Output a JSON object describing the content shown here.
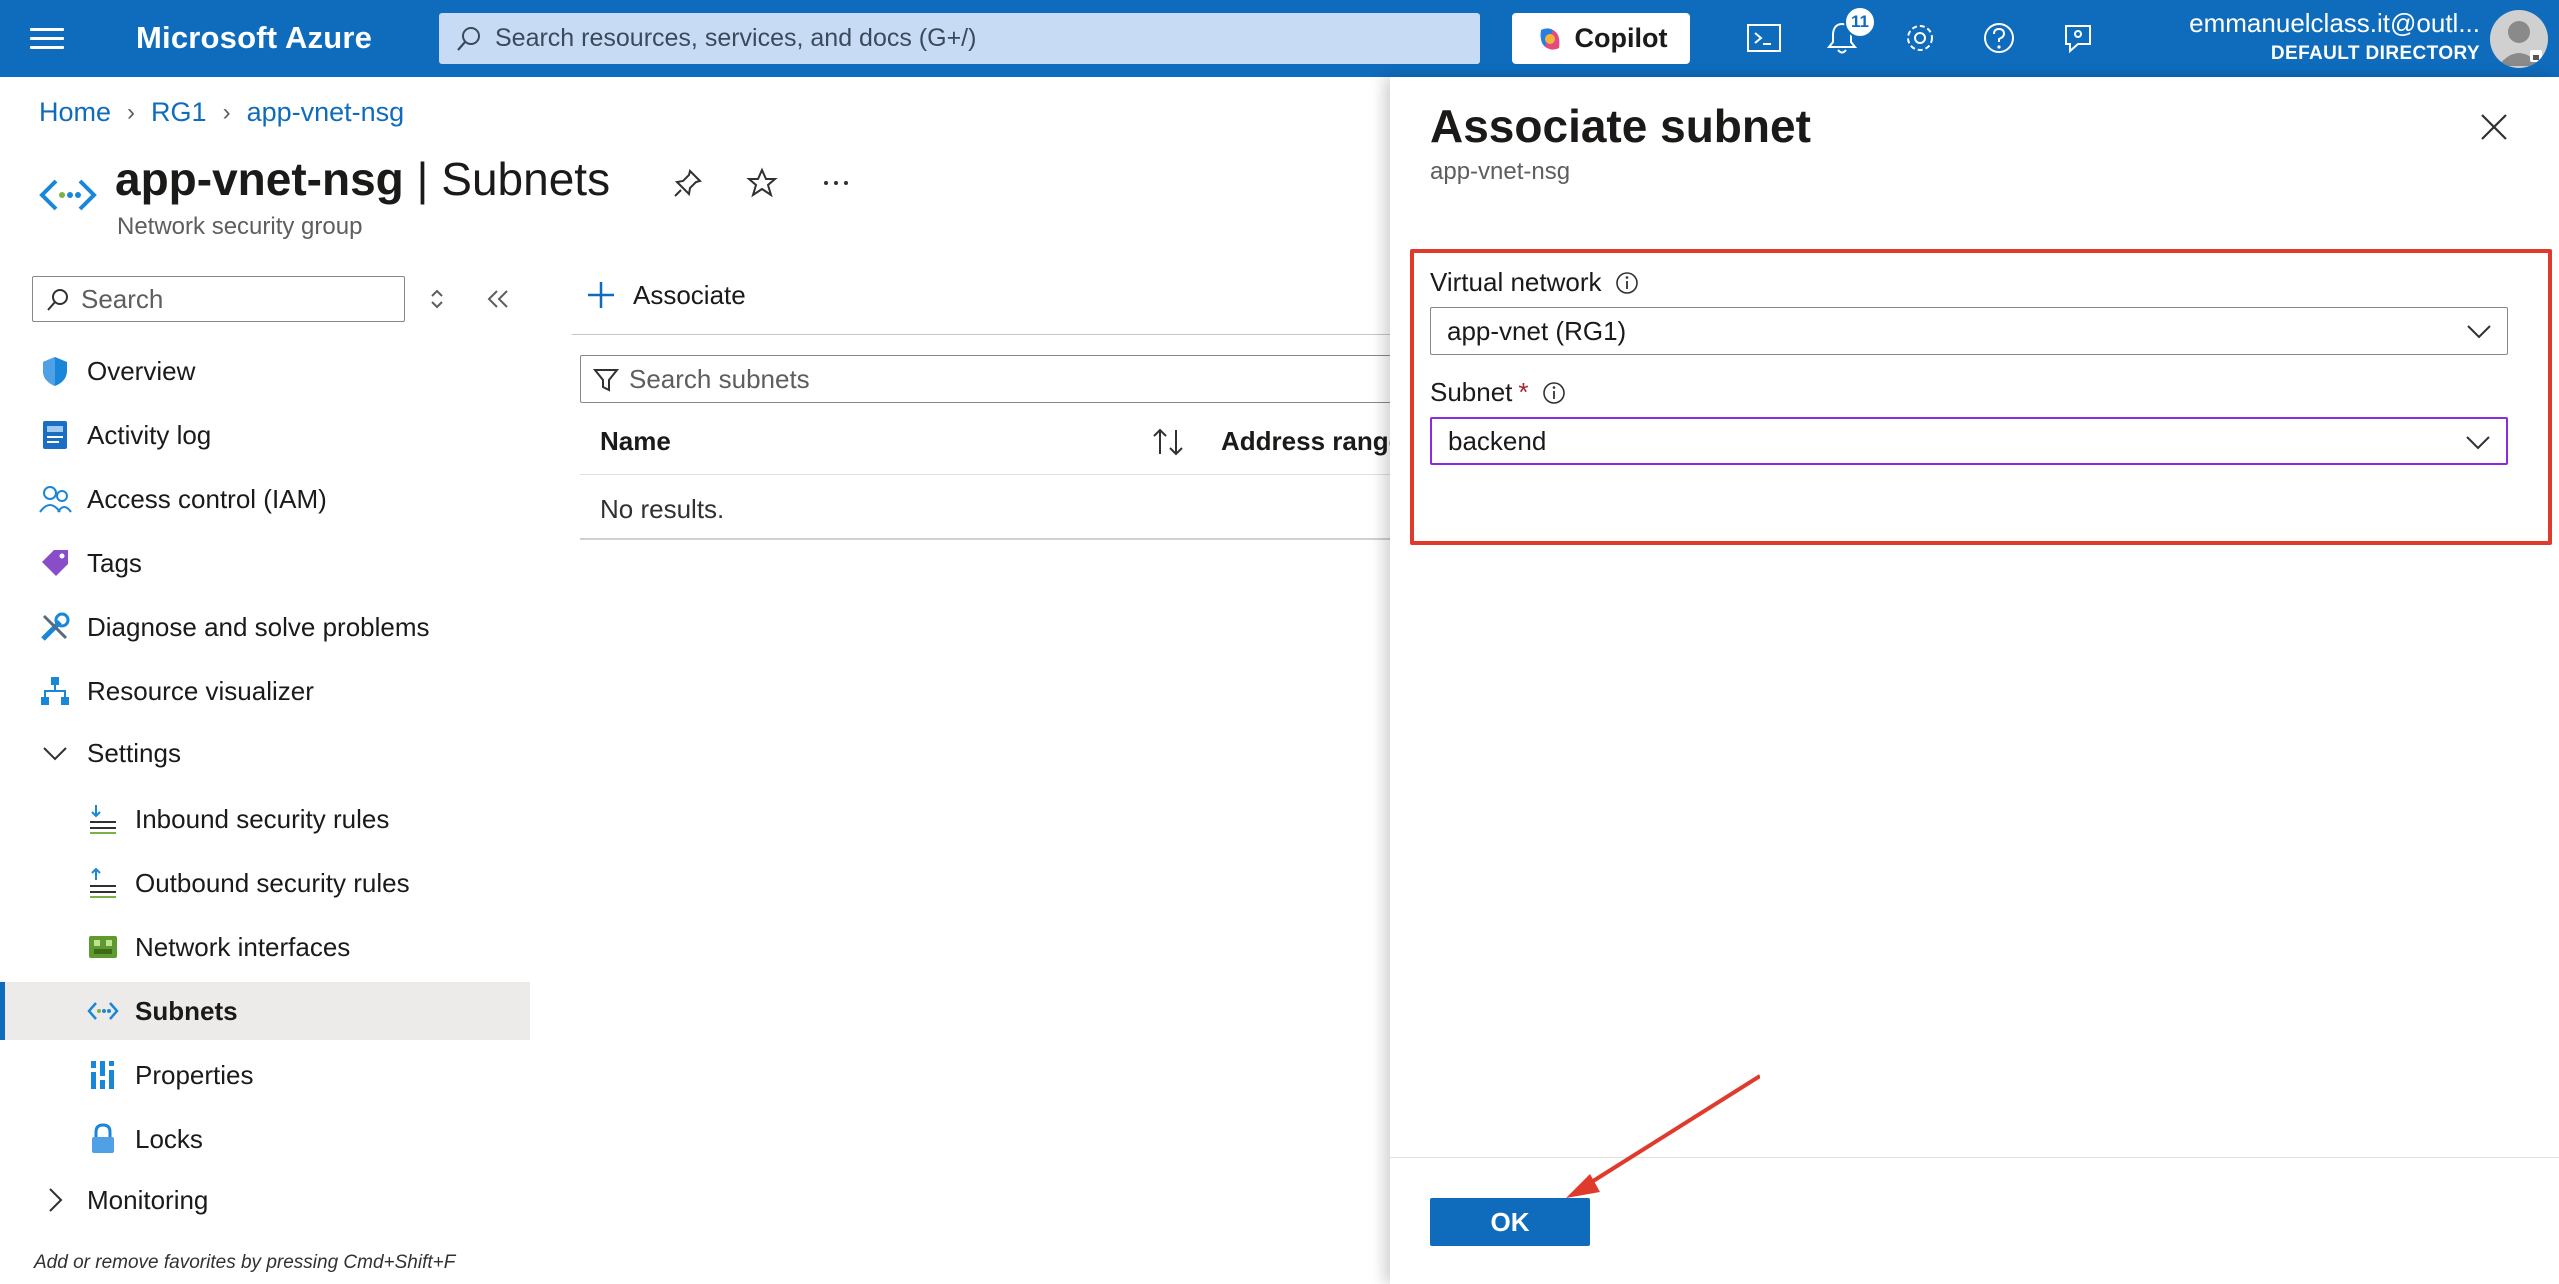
{
  "topbar": {
    "brand": "Microsoft Azure",
    "search_placeholder": "Search resources, services, and docs (G+/)",
    "copilot_label": "Copilot",
    "notification_count": "11",
    "account_email": "emmanuelclass.it@outl...",
    "account_directory": "DEFAULT DIRECTORY",
    "icons": [
      "cloud-shell-icon",
      "notifications-icon",
      "settings-icon",
      "help-icon",
      "feedback-icon"
    ]
  },
  "breadcrumb": {
    "items": [
      "Home",
      "RG1",
      "app-vnet-nsg"
    ]
  },
  "page": {
    "resource_name": "app-vnet-nsg",
    "section": " | Subnets",
    "subtitle": "Network security group"
  },
  "left_menu": {
    "search_placeholder": "Search",
    "items": [
      {
        "label": "Overview",
        "icon": "shield-icon"
      },
      {
        "label": "Activity log",
        "icon": "activity-log-icon"
      },
      {
        "label": "Access control (IAM)",
        "icon": "people-icon"
      },
      {
        "label": "Tags",
        "icon": "tag-icon"
      },
      {
        "label": "Diagnose and solve problems",
        "icon": "wrench-icon"
      },
      {
        "label": "Resource visualizer",
        "icon": "hierarchy-icon"
      },
      {
        "label": "Settings",
        "icon": "chevron-down-icon"
      },
      {
        "label": "Inbound security rules",
        "icon": "inbound-rules-icon"
      },
      {
        "label": "Outbound security rules",
        "icon": "outbound-rules-icon"
      },
      {
        "label": "Network interfaces",
        "icon": "network-interface-icon"
      },
      {
        "label": "Subnets",
        "icon": "subnet-icon",
        "selected": true
      },
      {
        "label": "Properties",
        "icon": "properties-icon"
      },
      {
        "label": "Locks",
        "icon": "lock-icon"
      },
      {
        "label": "Monitoring",
        "icon": "chevron-right-icon"
      }
    ],
    "favorites_hint": "Add or remove favorites by pressing Cmd+Shift+F"
  },
  "content": {
    "associate_label": "Associate",
    "search_placeholder": "Search subnets",
    "columns": [
      "Name",
      "Address range"
    ],
    "empty_text": "No results."
  },
  "panel": {
    "title": "Associate subnet",
    "subtitle": "app-vnet-nsg",
    "vnet_label": "Virtual network",
    "vnet_value": "app-vnet (RG1)",
    "subnet_label": "Subnet",
    "subnet_required": "*",
    "subnet_value": "backend",
    "ok_label": "OK"
  },
  "colors": {
    "azure_blue": "#0f6cbd",
    "highlight_red": "#e03a2c",
    "focus_purple": "#8a2be2"
  }
}
